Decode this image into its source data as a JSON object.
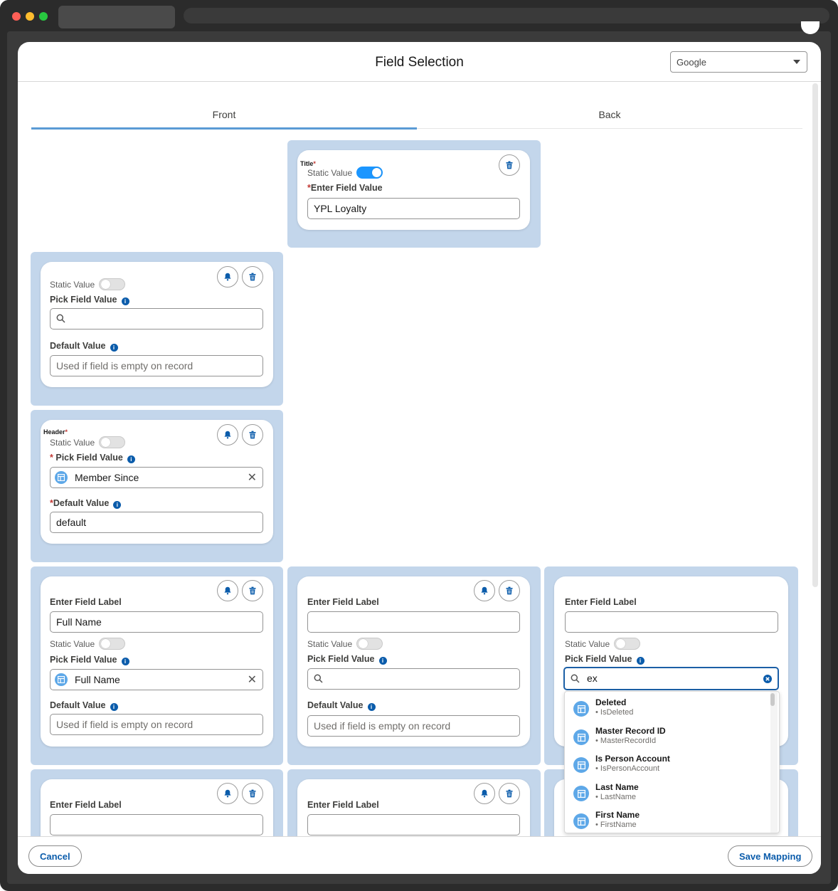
{
  "modal": {
    "title": "Field Selection",
    "select_value": "Google",
    "tabs": [
      {
        "label": "Front",
        "active": true
      },
      {
        "label": "Back",
        "active": false
      }
    ]
  },
  "common": {
    "static_value": "Static Value",
    "pick_field_value": "Pick Field Value",
    "default_value": "Default Value",
    "enter_field_label": "Enter Field Label",
    "enter_field_value": "Enter Field Value",
    "default_placeholder": "Used if field is empty on record",
    "required_mark": "*",
    "info_glyph": "i"
  },
  "cards": {
    "title_card": {
      "tag": "Title",
      "static_on": true,
      "value": "YPL Loyalty"
    },
    "card2": {
      "static_on": false,
      "search_value": ""
    },
    "header_card": {
      "tag": "Header",
      "static_on": false,
      "picked": "Member Since",
      "default_value": "default"
    },
    "row1_col1": {
      "label_value": "Full Name",
      "picked": "Full Name"
    },
    "row1_col2": {
      "label_value": "",
      "search_value": ""
    },
    "row1_col3": {
      "label_value": "",
      "search_value": "ex"
    }
  },
  "dropdown": {
    "items": [
      {
        "title": "Deleted",
        "api": "• IsDeleted"
      },
      {
        "title": "Master Record ID",
        "api": "• MasterRecordId"
      },
      {
        "title": "Is Person Account",
        "api": "• IsPersonAccount"
      },
      {
        "title": "Last Name",
        "api": "• LastName"
      },
      {
        "title": "First Name",
        "api": "• FirstName"
      }
    ]
  },
  "footer": {
    "cancel": "Cancel",
    "save": "Save Mapping"
  },
  "icons": {
    "bell": "bell-icon",
    "trash": "trash-icon",
    "search": "search-icon",
    "field": "table-field-icon",
    "clear": "clear-icon"
  },
  "colors": {
    "accent": "#0b5cab",
    "wrapper": "#c3d6eb",
    "toggle_on": "#1b96ff",
    "required": "#c23934"
  }
}
